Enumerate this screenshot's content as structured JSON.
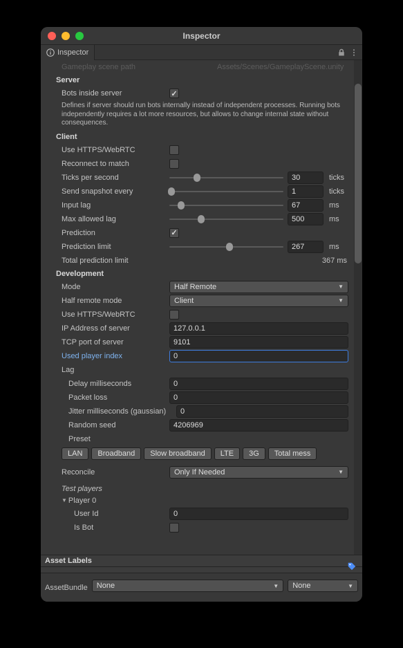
{
  "window": {
    "title": "Inspector"
  },
  "tab": {
    "label": "Inspector"
  },
  "cutoffRow": {
    "label": "Gameplay scene path",
    "value": "Assets/Scenes/GameplayScene.unity"
  },
  "server": {
    "heading": "Server",
    "botsInside": {
      "label": "Bots inside server",
      "checked": true
    },
    "desc": "Defines if server should run bots internally instead of independent processes. Running bots independently requires a lot more resources, but allows to change internal state without consequences."
  },
  "client": {
    "heading": "Client",
    "useHttps": {
      "label": "Use HTTPS/WebRTC",
      "checked": false
    },
    "reconnect": {
      "label": "Reconnect to match",
      "checked": false
    },
    "ticksPerSecond": {
      "label": "Ticks per second",
      "value": "30",
      "pct": 24,
      "unit": "ticks"
    },
    "sendSnapshot": {
      "label": "Send snapshot every",
      "value": "1",
      "pct": 2,
      "unit": "ticks"
    },
    "inputLag": {
      "label": "Input lag",
      "value": "67",
      "pct": 10,
      "unit": "ms"
    },
    "maxAllowedLag": {
      "label": "Max allowed lag",
      "value": "500",
      "pct": 28,
      "unit": "ms"
    },
    "prediction": {
      "label": "Prediction",
      "checked": true
    },
    "predictionLimit": {
      "label": "Prediction limit",
      "value": "267",
      "pct": 53,
      "unit": "ms"
    },
    "totalPrediction": {
      "label": "Total prediction limit",
      "value": "367 ms"
    }
  },
  "dev": {
    "heading": "Development",
    "mode": {
      "label": "Mode",
      "value": "Half Remote"
    },
    "halfRemoteMode": {
      "label": "Half remote mode",
      "value": "Client"
    },
    "useHttps": {
      "label": "Use HTTPS/WebRTC",
      "checked": false
    },
    "ip": {
      "label": "IP Address of server",
      "value": "127.0.0.1"
    },
    "tcp": {
      "label": "TCP port of server",
      "value": "9101"
    },
    "usedPlayerIndex": {
      "label": "Used player index",
      "value": "0"
    },
    "lag": {
      "heading": "Lag"
    },
    "delayMs": {
      "label": "Delay milliseconds",
      "value": "0"
    },
    "packetLoss": {
      "label": "Packet loss",
      "value": "0"
    },
    "jitterMs": {
      "label": "Jitter milliseconds (gaussian)",
      "value": "0"
    },
    "randomSeed": {
      "label": "Random seed",
      "value": "4206969"
    },
    "preset": {
      "label": "Preset",
      "buttons": [
        "LAN",
        "Broadband",
        "Slow broadband",
        "LTE",
        "3G",
        "Total mess"
      ]
    },
    "reconcile": {
      "label": "Reconcile",
      "value": "Only If Needed"
    },
    "testPlayers": {
      "heading": "Test players"
    },
    "player0": {
      "label": "Player 0",
      "userId": {
        "label": "User Id",
        "value": "0"
      },
      "isBot": {
        "label": "Is Bot",
        "checked": false
      }
    }
  },
  "assetLabels": {
    "heading": "Asset Labels"
  },
  "assetBundle": {
    "label": "AssetBundle",
    "main": "None",
    "variant": "None"
  }
}
